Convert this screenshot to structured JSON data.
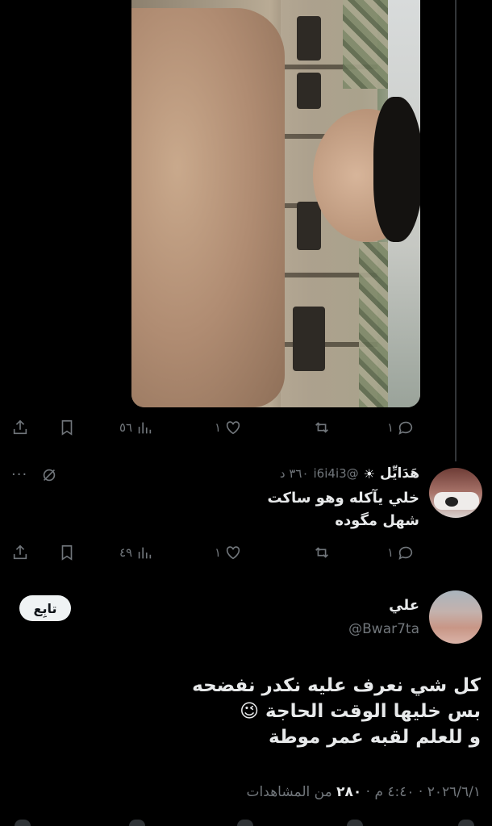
{
  "first_tweet": {
    "actions": {
      "replies": "١",
      "retweets": "",
      "likes": "١",
      "views": "٥٦"
    }
  },
  "reply": {
    "name": "هَدَايِّل",
    "badge": "☀",
    "handle": "@i6i4i3",
    "time": "٣٦٠ د",
    "text": "خلي يآكله وهو ساكت\nشهل مگوده",
    "actions": {
      "replies": "١",
      "retweets": "",
      "likes": "١",
      "views": "٤٩"
    },
    "more": "···"
  },
  "main_tweet": {
    "name": "علي",
    "handle": "@Bwar7ta",
    "follow_label": "تابِع",
    "text_line1": "كل شي نعرف عليه نكدر نفضحه",
    "text_line2": "بس خليها الوقت الحاجة 😉",
    "text_line3": "و للعلم لقبه عمر موطة",
    "time": "٤:٤٠ م",
    "date": "٢٠٢٦/٦/١",
    "views_count": "٢٨٠",
    "views_label": "من المشاهدات"
  },
  "icons": {
    "reply": "reply-icon",
    "retweet": "retweet-icon",
    "like": "heart-icon",
    "views": "views-icon",
    "bookmark": "bookmark-icon",
    "share": "share-icon"
  }
}
